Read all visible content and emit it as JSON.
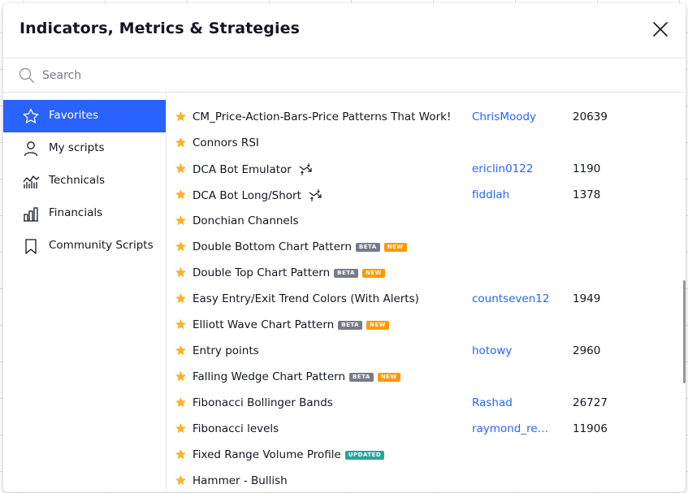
{
  "dialog": {
    "title": "Indicators, Metrics & Strategies",
    "close_icon": "close-icon"
  },
  "search": {
    "placeholder": "Search",
    "value": ""
  },
  "sidebar": {
    "items": [
      {
        "label": "Favorites",
        "icon": "star-icon",
        "active": true
      },
      {
        "label": "My scripts",
        "icon": "user-icon",
        "active": false
      },
      {
        "label": "Technicals",
        "icon": "technicals-chart-icon",
        "active": false
      },
      {
        "label": "Financials",
        "icon": "bar-chart-icon",
        "active": false
      },
      {
        "label": "Community Scripts",
        "icon": "bookmark-icon",
        "active": false
      }
    ]
  },
  "colors": {
    "accent": "#2962ff",
    "favorite_star": "#f7b42c",
    "badge_beta": "#787b86",
    "badge_new": "#ff9800",
    "badge_updated": "#26a69a"
  },
  "list": {
    "rows": [
      {
        "name": "CM_Price-Action-Bars-Price Patterns That Work!",
        "author": "ChrisMoody",
        "likes": "20639",
        "badges": [],
        "strategy": false
      },
      {
        "name": "Connors RSI",
        "author": "",
        "likes": "",
        "badges": [],
        "strategy": false
      },
      {
        "name": "DCA Bot Emulator",
        "author": "ericlin0122",
        "likes": "1190",
        "badges": [],
        "strategy": true
      },
      {
        "name": "DCA Bot Long/Short",
        "author": "fiddlah",
        "likes": "1378",
        "badges": [],
        "strategy": true
      },
      {
        "name": "Donchian Channels",
        "author": "",
        "likes": "",
        "badges": [],
        "strategy": false
      },
      {
        "name": "Double Bottom Chart Pattern",
        "author": "",
        "likes": "",
        "badges": [
          "BETA",
          "NEW"
        ],
        "strategy": false
      },
      {
        "name": "Double Top Chart Pattern",
        "author": "",
        "likes": "",
        "badges": [
          "BETA",
          "NEW"
        ],
        "strategy": false
      },
      {
        "name": "Easy Entry/Exit Trend Colors (With Alerts)",
        "author": "countseven12",
        "likes": "1949",
        "badges": [],
        "strategy": false
      },
      {
        "name": "Elliott Wave Chart Pattern",
        "author": "",
        "likes": "",
        "badges": [
          "BETA",
          "NEW"
        ],
        "strategy": false
      },
      {
        "name": "Entry points",
        "author": "hotowy",
        "likes": "2960",
        "badges": [],
        "strategy": false
      },
      {
        "name": "Falling Wedge Chart Pattern",
        "author": "",
        "likes": "",
        "badges": [
          "BETA",
          "NEW"
        ],
        "strategy": false
      },
      {
        "name": "Fibonacci Bollinger Bands",
        "author": "Rashad",
        "likes": "26727",
        "badges": [],
        "strategy": false
      },
      {
        "name": "Fibonacci levels",
        "author": "raymond_red…",
        "likes": "11906",
        "badges": [],
        "strategy": false
      },
      {
        "name": "Fixed Range Volume Profile",
        "author": "",
        "likes": "",
        "badges": [
          "UPDATED"
        ],
        "strategy": false
      },
      {
        "name": "Hammer - Bullish",
        "author": "",
        "likes": "",
        "badges": [],
        "strategy": false
      }
    ]
  }
}
